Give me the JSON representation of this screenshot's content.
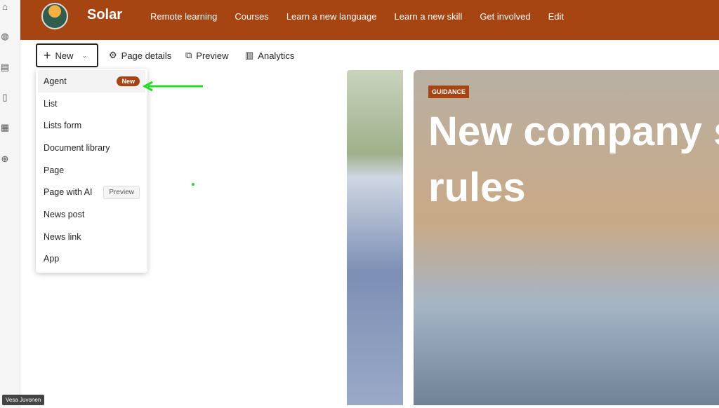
{
  "site": {
    "title": "Solar",
    "nav": [
      "Remote learning",
      "Courses",
      "Learn a new language",
      "Learn a new skill",
      "Get involved",
      "Edit"
    ]
  },
  "toolbar": {
    "new_label": "New",
    "page_details": "Page details",
    "preview": "Preview",
    "analytics": "Analytics"
  },
  "menu": {
    "items": [
      {
        "label": "Agent",
        "badge": "New"
      },
      {
        "label": "List"
      },
      {
        "label": "Lists form"
      },
      {
        "label": "Document library"
      },
      {
        "label": "Page"
      },
      {
        "label": "Page with AI",
        "badge": "Preview"
      },
      {
        "label": "News post"
      },
      {
        "label": "News link"
      },
      {
        "label": "App"
      }
    ]
  },
  "hero": {
    "tag": "GUIDANCE",
    "title_line1": "New company s",
    "title_line2": "rules"
  },
  "user_tooltip": "Vesa Juvonen",
  "colors": {
    "brand": "#a64412",
    "arrow": "#22dd22"
  }
}
